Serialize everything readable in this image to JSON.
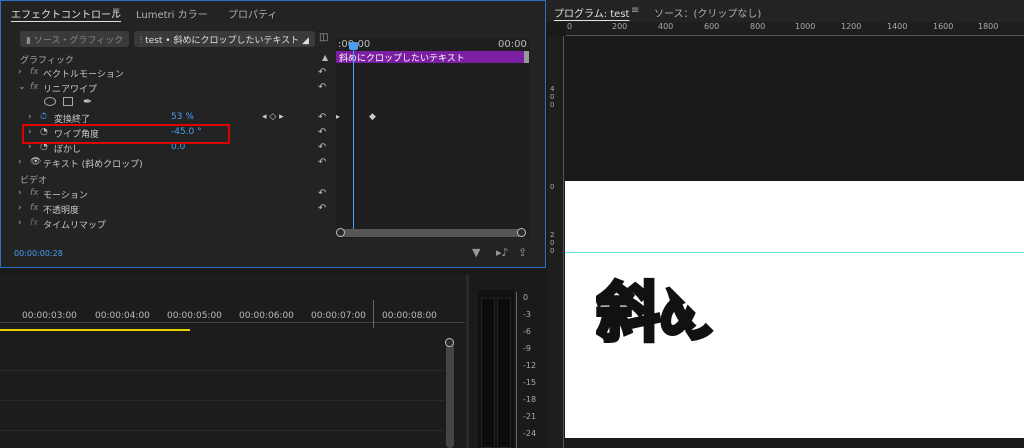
{
  "effect_controls": {
    "tabs": [
      "エフェクトコントロール",
      "Lumetri カラー",
      "プロパティ"
    ],
    "menu_icon": "≡",
    "source_label": "ソース・グラフィック",
    "clip_label": "test • 斜めにクロップしたいテキスト",
    "sections": {
      "graphic": "グラフィック",
      "video": "ビデオ"
    },
    "rows": {
      "vector_motion": "ベクトルモーション",
      "linear_wipe": "リニアワイプ",
      "transition_end": "変換終了",
      "transition_end_value": "53 %",
      "wipe_angle": "ワイプ角度",
      "wipe_angle_value": "-45.0 °",
      "feather": "ぼかし",
      "feather_value": "0.0",
      "text_layer": "テキスト (斜めクロップ)",
      "motion": "モーション",
      "opacity": "不透明度",
      "time_remap": "タイムリマップ"
    },
    "ruler_start": ":00:00",
    "ruler_end": "00:00",
    "clip_bar_label": "斜めにクロップしたいテキスト",
    "timecode": "00:00:00:28"
  },
  "program_monitor": {
    "tab_program": "プログラム: test",
    "tab_menu": "≡",
    "tab_source": "ソース：(クリップなし)",
    "ruler_ticks": [
      "0",
      "200",
      "400",
      "600",
      "800",
      "1000",
      "1200",
      "1400",
      "1600",
      "1800"
    ],
    "vruler_top": [
      "4",
      "0",
      "0"
    ],
    "vruler_mid": [
      "2",
      "0",
      "0"
    ],
    "vruler_zero": "0",
    "canvas_text": "斜めク"
  },
  "timeline": {
    "timecodes": [
      "00:00:03:00",
      "00:00:04:00",
      "00:00:05:00",
      "00:00:06:00",
      "00:00:07:00",
      "00:00:08:00"
    ]
  },
  "audio_meter": {
    "db_labels": [
      "0",
      "-3",
      "-6",
      "-9",
      "-12",
      "-15",
      "-18",
      "-21",
      "-24"
    ]
  },
  "colors": {
    "accent_blue": "#4a9ff5",
    "clip_purple": "#7b1fa2",
    "highlight_red": "#e00000",
    "text_cyan": "#20e0c8",
    "playhead_yellow": "#e6d200"
  }
}
